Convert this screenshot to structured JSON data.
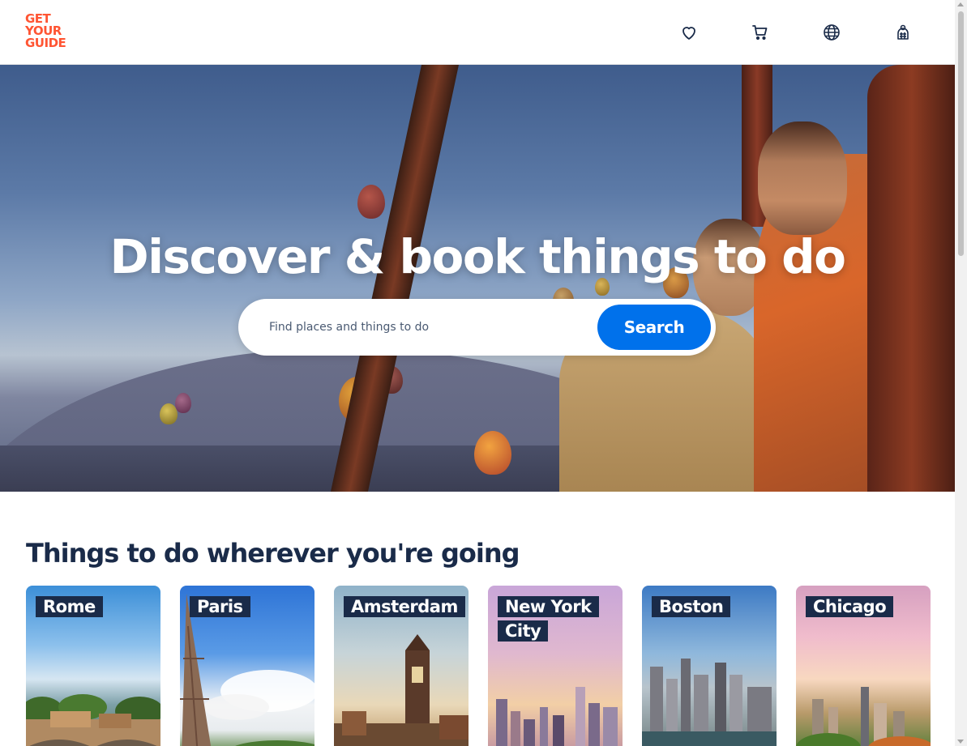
{
  "header": {
    "logo": [
      "GET",
      "YOUR",
      "GUIDE"
    ],
    "icons": [
      "heart-icon",
      "cart-icon",
      "globe-icon",
      "profile-icon"
    ]
  },
  "hero": {
    "title": "Discover & book things to do",
    "search": {
      "placeholder": "Find places and things to do",
      "value": "",
      "button_label": "Search"
    }
  },
  "section": {
    "title": "Things to do wherever you're going",
    "destinations": [
      {
        "label": "Rome"
      },
      {
        "label": "Paris"
      },
      {
        "label": "Amsterdam"
      },
      {
        "label": "New York City"
      },
      {
        "label": "Boston"
      },
      {
        "label": "Chicago"
      }
    ]
  },
  "colors": {
    "brand": "#ff5533",
    "primary": "#0071eb",
    "navy": "#1a2b49"
  }
}
